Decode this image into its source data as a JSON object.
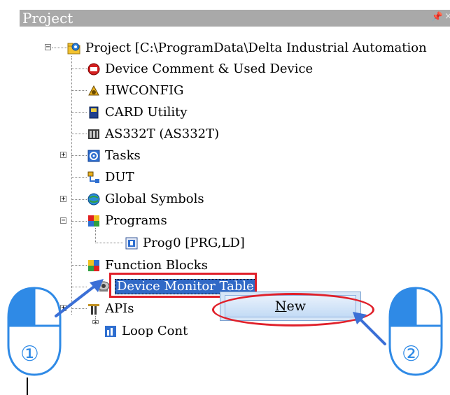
{
  "panel": {
    "title": "Project",
    "pin_glyph": "⻾",
    "close_glyph": "×"
  },
  "tree": {
    "root": "Project [C:\\ProgramData\\Delta Industrial Automation",
    "items": [
      {
        "label": "Device Comment & Used Device",
        "icon": "device-comment-icon"
      },
      {
        "label": "HWCONFIG",
        "icon": "hwconfig-icon"
      },
      {
        "label": "CARD Utility",
        "icon": "card-utility-icon"
      },
      {
        "label": "AS332T  (AS332T)",
        "icon": "plc-module-icon"
      },
      {
        "label": "Tasks",
        "icon": "tasks-icon"
      },
      {
        "label": "DUT",
        "icon": "dut-icon"
      },
      {
        "label": "Global Symbols",
        "icon": "global-symbols-icon"
      },
      {
        "label": "Programs",
        "icon": "programs-icon"
      },
      {
        "label": "Prog0 [PRG,LD]",
        "icon": "program-file-icon"
      },
      {
        "label": "Function Blocks",
        "icon": "function-blocks-icon"
      },
      {
        "label": "Device Monitor Table",
        "icon": "monitor-table-icon"
      },
      {
        "label": "APIs",
        "icon": "apis-icon"
      },
      {
        "label": "Loop Cont",
        "icon": "loop-control-icon"
      }
    ]
  },
  "context_menu": {
    "item_new_first": "N",
    "item_new_rest": "ew"
  },
  "annotations": {
    "step1": "①",
    "step2": "②",
    "highlight_color": "#e0202a",
    "arrow_color": "#3b6fd6",
    "mouse_color": "#2f8ae6"
  }
}
